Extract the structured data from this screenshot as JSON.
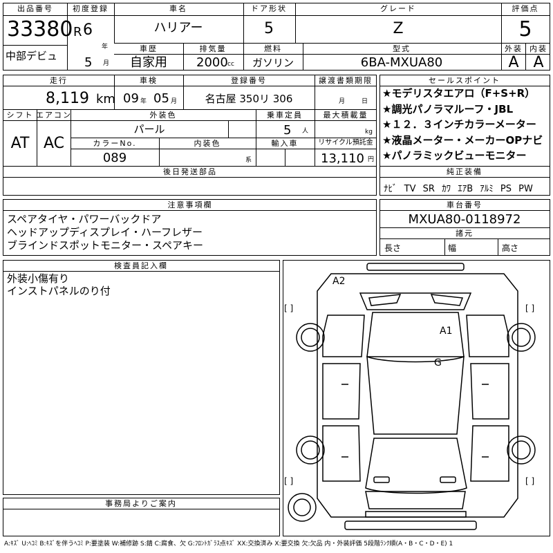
{
  "header": {
    "lot_label": "出品番号",
    "lot_number": "33380",
    "lot_sub": "中部デビュ",
    "first_reg_label": "初度登録",
    "era": "R",
    "year": "6",
    "year_unit": "年",
    "month": "5",
    "month_unit": "月",
    "car_name_label": "車名",
    "car_name": "ハリアー",
    "door_label": "ドア形状",
    "door": "5",
    "grade_label": "グレード",
    "grade": "Z",
    "score_label": "評価点",
    "score": "5",
    "history_label": "車歴",
    "history": "自家用",
    "displacement_label": "排気量",
    "displacement": "2000",
    "displacement_unit": "cc",
    "fuel_label": "燃料",
    "fuel": "ガソリン",
    "model_label": "型式",
    "model": "6BA-MXUA80",
    "exterior_label": "外装",
    "exterior_grade": "A",
    "interior_label": "内装",
    "interior_grade": "A"
  },
  "row2": {
    "mileage_label": "走行",
    "mileage": "8,119",
    "mileage_unit": "km",
    "inspection_label": "車検",
    "insp_year": "09",
    "insp_year_unit": "年",
    "insp_month": "05",
    "insp_month_unit": "月",
    "reg_label": "登録番号",
    "reg_number": "名古屋 350リ 306",
    "transfer_label": "譲渡書類期限",
    "transfer_month_unit": "月",
    "transfer_day_unit": "日",
    "shift_label": "シフト",
    "shift": "AT",
    "ac_label": "エアコン",
    "ac": "AC",
    "ext_color_label": "外装色",
    "ext_color": "パール",
    "capacity_label": "乗車定員",
    "capacity": "5",
    "capacity_unit": "人",
    "load_label": "最大積載量",
    "load_unit": "kg",
    "color_no_label": "カラーNo.",
    "color_no": "089",
    "int_color_label": "内装色",
    "int_color_unit": "系",
    "import_label": "輸入車",
    "recycle_label": "リサイクル預託金",
    "recycle": "13,110",
    "recycle_unit": "円",
    "later_parts_label": "後日発送部品"
  },
  "sales_points": {
    "label": "セールスポイント",
    "items": [
      "★モデリスタエアロ（F+S+R）",
      "★調光パノラマルーフ・JBL",
      "★１２．３インチカラーメーター",
      "★液晶メーター・メーカーOPナビ",
      "★パノラミックビューモニター"
    ]
  },
  "equipment": {
    "label": "純正装備",
    "items": [
      "ﾅﾋﾞ",
      "TV",
      "SR",
      "ｶﾜ",
      "ｴｱB",
      "ｱﾙﾐ",
      "PS",
      "PW"
    ]
  },
  "notes": {
    "label": "注意事項欄",
    "lines": [
      "スペアタイヤ・パワーバックドア",
      "ヘッドアップディスプレイ・ハーフレザー",
      "ブラインドスポットモニター・スペアキー"
    ]
  },
  "chassis": {
    "label": "車台番号",
    "number": "MXUA80-0118972",
    "dims_label": "諸元",
    "length_label": "長さ",
    "width_label": "幅",
    "height_label": "高さ"
  },
  "inspector": {
    "label": "検査員記入欄",
    "lines": [
      "外装小傷有り",
      "インストパネルのり付"
    ]
  },
  "office": {
    "label": "事務局よりご案内"
  },
  "diagram": {
    "marks": [
      "A2",
      "A1",
      "G"
    ],
    "bracket": "[  ]"
  },
  "legend": "A:ｷｽﾞ U:ﾍｺﾐ B:ｷｽﾞを伴うﾍｺﾐ P:要塗装 W:補修跡 S:錆 C:腐食、欠 G:ﾌﾛﾝﾄｶﾞﾗｽ点ｷｽﾞ XX:交換済み X:要交換 欠:欠品 内・外装評価 5段階ﾗﾝｸ順(A・B・C・D・E) 1"
}
